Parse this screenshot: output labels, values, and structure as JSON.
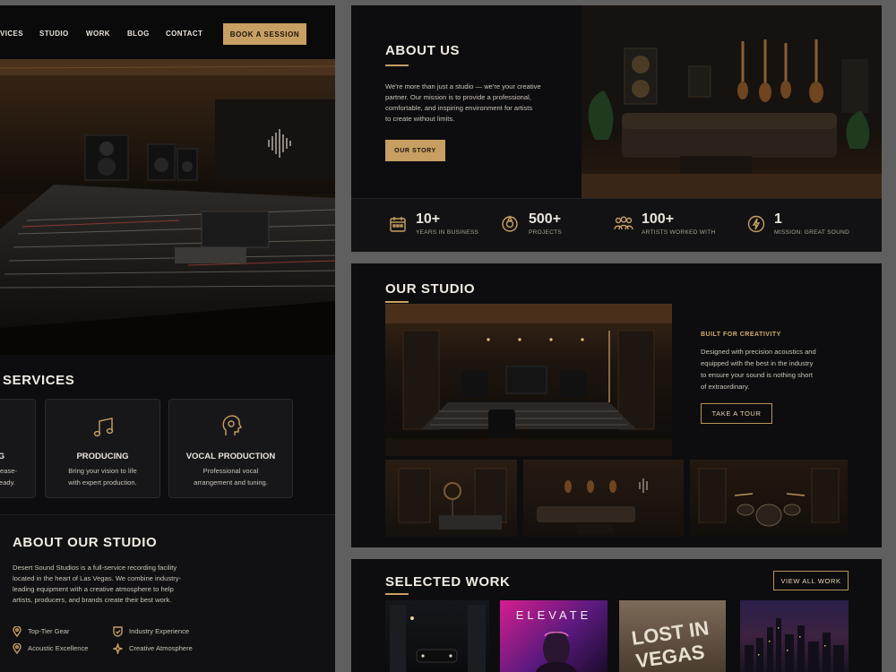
{
  "nav": {
    "items": [
      "VICES",
      "STUDIO",
      "WORK",
      "BLOG",
      "CONTACT"
    ],
    "cta": "BOOK A SESSION"
  },
  "services": {
    "title": "SERVICES",
    "partial_card": {
      "title": "G",
      "line1": "ease-",
      "line2": "eady."
    },
    "cards": [
      {
        "icon": "music-note-icon",
        "title": "PRODUCING",
        "line1": "Bring your vision to life",
        "line2": "with expert production."
      },
      {
        "icon": "head-profile-icon",
        "title": "VOCAL PRODUCTION",
        "line1": "Professional vocal",
        "line2": "arrangement and tuning."
      }
    ]
  },
  "about_studio": {
    "title": "ABOUT OUR STUDIO",
    "lines": [
      "Desert Sound Studios is a full-service recording facility",
      "located in the heart of Las Vegas. We combine industry-",
      "leading equipment with a creative atmosphere to help",
      "artists, producers, and brands create their best work."
    ],
    "features": [
      {
        "icon": "pin-icon",
        "label": "Top-Tier Gear"
      },
      {
        "icon": "check-shield-icon",
        "label": "Industry Experience"
      },
      {
        "icon": "pin-icon",
        "label": "Acoustic Excellence"
      },
      {
        "icon": "sparkle-icon",
        "label": "Creative Atmosphere"
      }
    ]
  },
  "about_us": {
    "title": "ABOUT US",
    "lines": [
      "We're more than just a studio — we're your creative",
      "partner. Our mission is to provide a professional,",
      "comfortable, and inspiring environment for artists",
      "to create without limits."
    ],
    "button": "OUR STORY"
  },
  "stats": [
    {
      "icon": "calendar-icon",
      "value": "10+",
      "label": "YEARS IN BUSINESS"
    },
    {
      "icon": "record-icon",
      "value": "500+",
      "label": "PROJECTS"
    },
    {
      "icon": "people-icon",
      "value": "100+",
      "label": "ARTISTS WORKED WITH"
    },
    {
      "icon": "bolt-icon",
      "value": "1",
      "label": "MISSION: GREAT SOUND"
    }
  ],
  "our_studio": {
    "title": "OUR STUDIO",
    "kicker": "BUILT FOR CREATIVITY",
    "lines": [
      "Designed with precision acoustics and",
      "equipped with the best in the industry",
      "to ensure your sound is nothing short",
      "of extraordinary."
    ],
    "button": "TAKE A TOUR"
  },
  "selected_work": {
    "title": "SELECTED WORK",
    "button": "VIEW ALL WORK",
    "covers": [
      {
        "text": ""
      },
      {
        "text": "ELEVATE"
      },
      {
        "text": "LOST IN",
        "text2": "VEGAS"
      },
      {
        "text": ""
      }
    ]
  },
  "colors": {
    "accent": "#c89f63",
    "panel": "#0d0d0f",
    "backdrop": "#5f5f5f"
  }
}
